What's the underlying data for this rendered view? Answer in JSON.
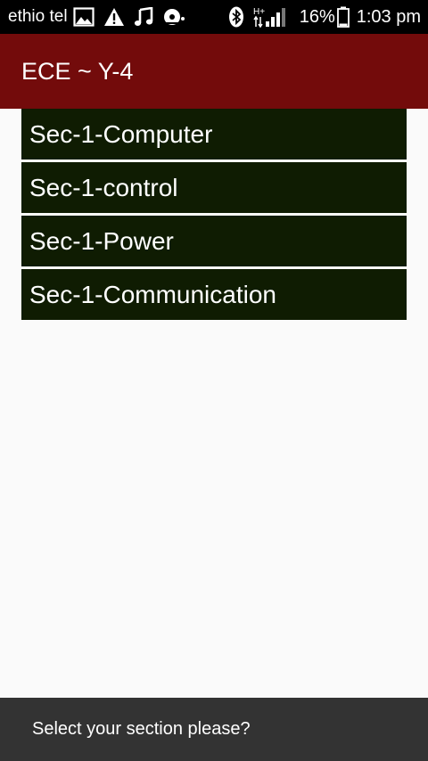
{
  "status_bar": {
    "carrier": "ethio tel",
    "battery_percent": "16%",
    "time": "1:03 pm",
    "network_type": "H+",
    "icons": [
      "image-icon",
      "warning-icon",
      "music-icon",
      "media-icon",
      "bluetooth-icon",
      "signal-icon",
      "battery-icon"
    ]
  },
  "action_bar": {
    "title": "ECE ~ Y-4",
    "color": "#730b0b"
  },
  "sections": [
    {
      "label": "Sec-1-Computer"
    },
    {
      "label": "Sec-1-control"
    },
    {
      "label": "Sec-1-Power"
    },
    {
      "label": "Sec-1-Communication"
    }
  ],
  "list_item_color": "#0f1c02",
  "snackbar": {
    "text": "Select your section please?"
  }
}
